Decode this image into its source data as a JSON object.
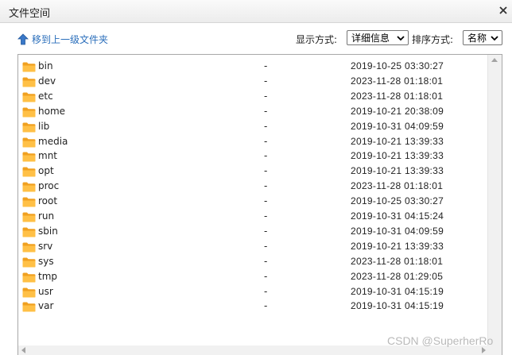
{
  "window": {
    "title": "文件空间",
    "close_icon": "close-icon"
  },
  "toolbar": {
    "up_label": "移到上一级文件夹",
    "up_icon": "arrow-up-icon",
    "display_label": "显示方式:",
    "display_value": "详细信息",
    "sort_label": "排序方式:",
    "sort_value": "名称"
  },
  "files": [
    {
      "name": "bin",
      "size": "-",
      "date": "2019-10-25 03:30:27"
    },
    {
      "name": "dev",
      "size": "-",
      "date": "2023-11-28 01:18:01"
    },
    {
      "name": "etc",
      "size": "-",
      "date": "2023-11-28 01:18:01"
    },
    {
      "name": "home",
      "size": "-",
      "date": "2019-10-21 20:38:09"
    },
    {
      "name": "lib",
      "size": "-",
      "date": "2019-10-31 04:09:59"
    },
    {
      "name": "media",
      "size": "-",
      "date": "2019-10-21 13:39:33"
    },
    {
      "name": "mnt",
      "size": "-",
      "date": "2019-10-21 13:39:33"
    },
    {
      "name": "opt",
      "size": "-",
      "date": "2019-10-21 13:39:33"
    },
    {
      "name": "proc",
      "size": "-",
      "date": "2023-11-28 01:18:01"
    },
    {
      "name": "root",
      "size": "-",
      "date": "2019-10-25 03:30:27"
    },
    {
      "name": "run",
      "size": "-",
      "date": "2019-10-31 04:15:24"
    },
    {
      "name": "sbin",
      "size": "-",
      "date": "2019-10-31 04:09:59"
    },
    {
      "name": "srv",
      "size": "-",
      "date": "2019-10-21 13:39:33"
    },
    {
      "name": "sys",
      "size": "-",
      "date": "2023-11-28 01:18:01"
    },
    {
      "name": "tmp",
      "size": "-",
      "date": "2023-11-28 01:29:05"
    },
    {
      "name": "usr",
      "size": "-",
      "date": "2019-10-31 04:15:19"
    },
    {
      "name": "var",
      "size": "-",
      "date": "2019-10-31 04:15:19"
    }
  ],
  "watermark": "CSDN @SuperherRo",
  "colors": {
    "folder": "#f5a623",
    "link": "#2a6ebb"
  }
}
